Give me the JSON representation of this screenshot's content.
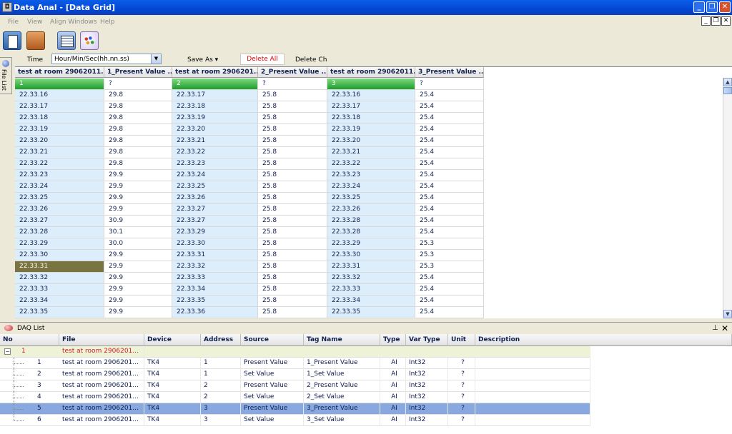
{
  "window": {
    "title": "Data Anal - [Data Grid]"
  },
  "menu": [
    "File",
    "View",
    "Align Windows",
    "Help"
  ],
  "options": {
    "time_label": "Time",
    "time_format": "Hour/Min/Sec(hh.nn.ss)",
    "save_as": "Save As ▾",
    "delete_all": "Delete All",
    "delete_ch": "Delete Ch"
  },
  "side_tab": "File List",
  "grid": {
    "headers": [
      "test at room 29062011....",
      "1_Present Value ...",
      "test at room 2906201...",
      "2_Present Value ...",
      "test at room 29062011...",
      "3_Present Value ..."
    ],
    "channel_row": [
      "1",
      "?",
      "2",
      "?",
      "3",
      "?"
    ],
    "rows": [
      [
        "22.33.16",
        "29.8",
        "22.33.17",
        "25.8",
        "22.33.16",
        "25.4"
      ],
      [
        "22.33.17",
        "29.8",
        "22.33.18",
        "25.8",
        "22.33.17",
        "25.4"
      ],
      [
        "22.33.18",
        "29.8",
        "22.33.19",
        "25.8",
        "22.33.18",
        "25.4"
      ],
      [
        "22.33.19",
        "29.8",
        "22.33.20",
        "25.8",
        "22.33.19",
        "25.4"
      ],
      [
        "22.33.20",
        "29.8",
        "22.33.21",
        "25.8",
        "22.33.20",
        "25.4"
      ],
      [
        "22.33.21",
        "29.8",
        "22.33.22",
        "25.8",
        "22.33.21",
        "25.4"
      ],
      [
        "22.33.22",
        "29.8",
        "22.33.23",
        "25.8",
        "22.33.22",
        "25.4"
      ],
      [
        "22.33.23",
        "29.9",
        "22.33.24",
        "25.8",
        "22.33.23",
        "25.4"
      ],
      [
        "22.33.24",
        "29.9",
        "22.33.25",
        "25.8",
        "22.33.24",
        "25.4"
      ],
      [
        "22.33.25",
        "29.9",
        "22.33.26",
        "25.8",
        "22.33.25",
        "25.4"
      ],
      [
        "22.33.26",
        "29.9",
        "22.33.27",
        "25.8",
        "22.33.26",
        "25.4"
      ],
      [
        "22.33.27",
        "30.9",
        "22.33.27",
        "25.8",
        "22.33.28",
        "25.4"
      ],
      [
        "22.33.28",
        "30.1",
        "22.33.29",
        "25.8",
        "22.33.28",
        "25.4"
      ],
      [
        "22.33.29",
        "30.0",
        "22.33.30",
        "25.8",
        "22.33.29",
        "25.3"
      ],
      [
        "22.33.30",
        "29.9",
        "22.33.31",
        "25.8",
        "22.33.30",
        "25.3"
      ],
      [
        "22.33.31",
        "29.9",
        "22.33.32",
        "25.8",
        "22.33.31",
        "25.3"
      ],
      [
        "22.33.32",
        "29.9",
        "22.33.33",
        "25.8",
        "22.33.32",
        "25.4"
      ],
      [
        "22.33.33",
        "29.9",
        "22.33.34",
        "25.8",
        "22.33.33",
        "25.4"
      ],
      [
        "22.33.34",
        "29.9",
        "22.33.35",
        "25.8",
        "22.33.34",
        "25.4"
      ],
      [
        "22.33.35",
        "29.9",
        "22.33.36",
        "25.8",
        "22.33.35",
        "25.4"
      ]
    ],
    "selected_row_index": 15
  },
  "daq": {
    "title": "DAQ List",
    "headers": [
      "No",
      "File",
      "Device",
      "Address",
      "Source",
      "Tag Name",
      "Type",
      "Var Type",
      "Unit",
      "Description"
    ],
    "parent": {
      "no": "1",
      "file": "test at room 2906201..."
    },
    "rows": [
      [
        "1",
        "test at room 2906201...",
        "TK4",
        "1",
        "Present Value",
        "1_Present Value",
        "AI",
        "Int32",
        "?",
        ""
      ],
      [
        "2",
        "test at room 2906201...",
        "TK4",
        "1",
        "Set Value",
        "1_Set Value",
        "AI",
        "Int32",
        "?",
        ""
      ],
      [
        "3",
        "test at room 2906201...",
        "TK4",
        "2",
        "Present Value",
        "2_Present Value",
        "AI",
        "Int32",
        "?",
        ""
      ],
      [
        "4",
        "test at room 2906201...",
        "TK4",
        "2",
        "Set Value",
        "2_Set Value",
        "AI",
        "Int32",
        "?",
        ""
      ],
      [
        "5",
        "test at room 2906201...",
        "TK4",
        "3",
        "Present Value",
        "3_Present Value",
        "AI",
        "Int32",
        "?",
        ""
      ],
      [
        "6",
        "test at room 2906201...",
        "TK4",
        "3",
        "Set Value",
        "3_Set Value",
        "AI",
        "Int32",
        "?",
        ""
      ]
    ],
    "selected_row_index": 4
  }
}
